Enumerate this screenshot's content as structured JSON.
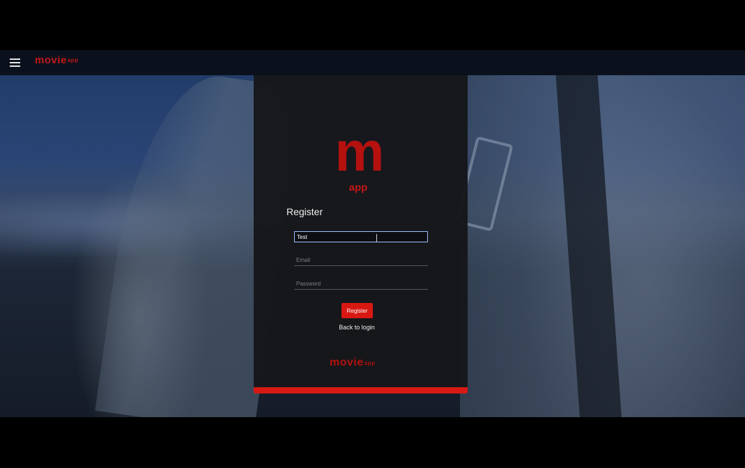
{
  "topbar": {
    "menu_icon": "menu-icon",
    "brand_main": "movie",
    "brand_suffix": "app"
  },
  "panel": {
    "logo_letter": "m",
    "logo_sub": "app",
    "title": "Register",
    "fields": {
      "name_value": "Test",
      "email_placeholder": "Email",
      "password_placeholder": "Password"
    },
    "register_label": "Register",
    "back_label": "Back to login",
    "footer_brand_main": "movie",
    "footer_brand_suffix": "app"
  },
  "colors": {
    "accent": "#d81812",
    "panel_bg": "#16171a",
    "brand_red": "#c2181a"
  }
}
